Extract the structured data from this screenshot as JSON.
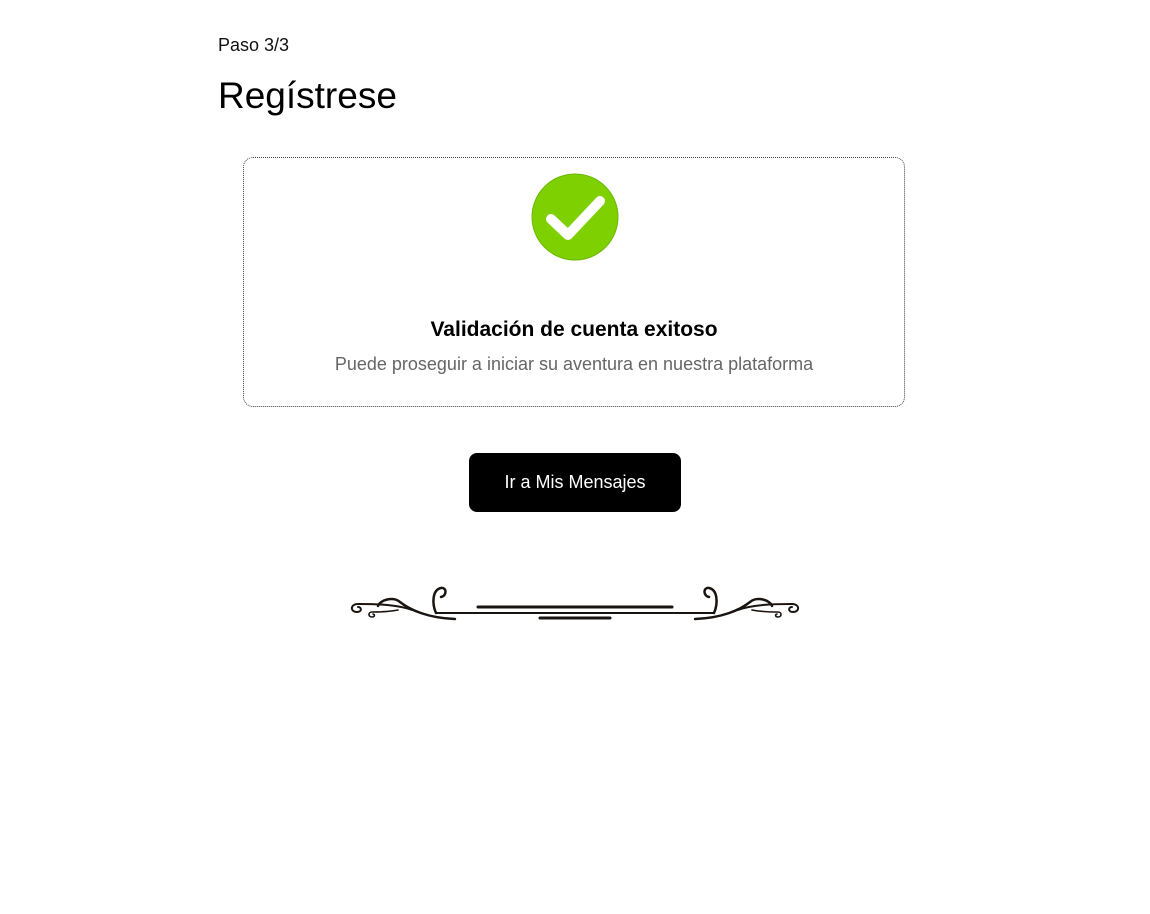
{
  "header": {
    "step": "Paso 3/3",
    "title": "Regístrese"
  },
  "card": {
    "icon": "check-circle-icon",
    "icon_color": "#7ed000",
    "title": "Validación de cuenta exitoso",
    "subtitle": "Puede proseguir a iniciar su aventura en nuestra plataforma"
  },
  "actions": {
    "primary_label": "Ir a Mis Mensajes",
    "primary_bg": "#000000"
  },
  "decoration": {
    "icon": "ornamental-divider-icon"
  }
}
